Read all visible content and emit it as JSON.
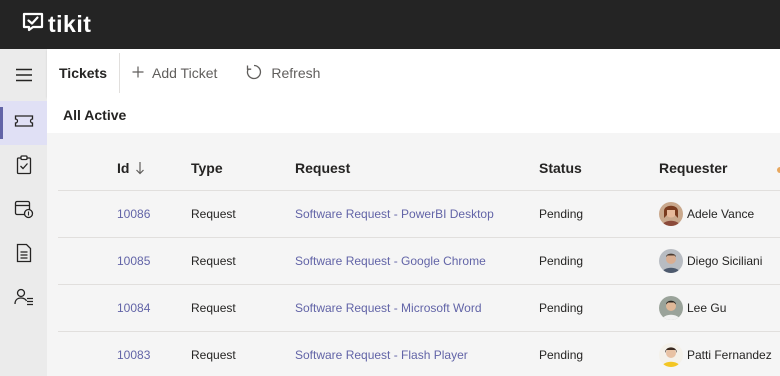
{
  "app": {
    "logo_text": "tikit"
  },
  "sidebar": {
    "items": [
      {
        "icon": "hamburger-icon"
      },
      {
        "icon": "ticket-icon",
        "active": true
      },
      {
        "icon": "clipboard-icon"
      },
      {
        "icon": "calendar-money-icon"
      },
      {
        "icon": "document-icon"
      },
      {
        "icon": "people-list-icon"
      }
    ]
  },
  "toolbar": {
    "title": "Tickets",
    "add_label": "Add Ticket",
    "refresh_label": "Refresh"
  },
  "view": {
    "title": "All Active"
  },
  "table": {
    "columns": {
      "id": "Id",
      "type": "Type",
      "request": "Request",
      "status": "Status",
      "requester": "Requester"
    },
    "rows": [
      {
        "id": "10086",
        "type": "Request",
        "request": "Software Request - PowerBI Desktop",
        "status": "Pending",
        "requester": "Adele Vance"
      },
      {
        "id": "10085",
        "type": "Request",
        "request": "Software Request - Google Chrome",
        "status": "Pending",
        "requester": "Diego Siciliani"
      },
      {
        "id": "10084",
        "type": "Request",
        "request": "Software Request - Microsoft Word",
        "status": "Pending",
        "requester": "Lee Gu"
      },
      {
        "id": "10083",
        "type": "Request",
        "request": "Software Request - Flash Player",
        "status": "Pending",
        "requester": "Patti Fernandez"
      }
    ]
  },
  "colors": {
    "accent": "#6264a7",
    "topbar": "#242424"
  }
}
